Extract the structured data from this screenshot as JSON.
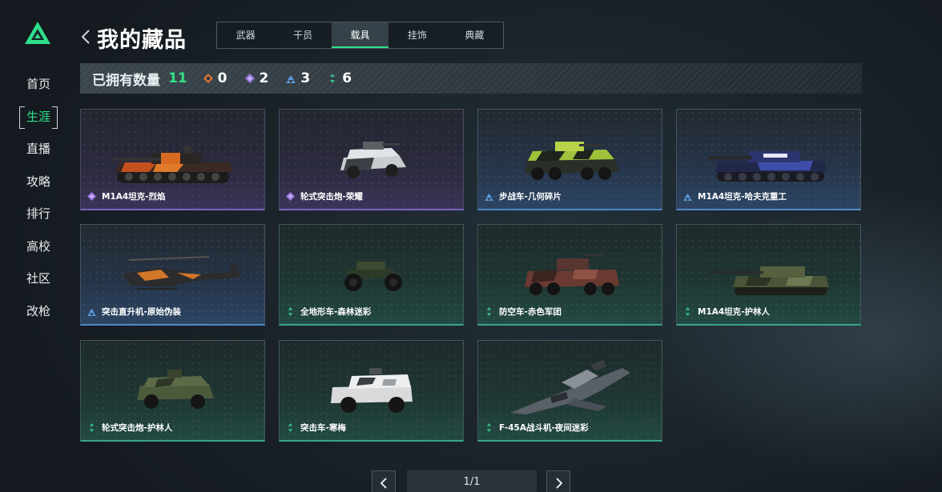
{
  "sidebar": {
    "items": [
      {
        "label": "首页",
        "active": false
      },
      {
        "label": "生涯",
        "active": true
      },
      {
        "label": "直播",
        "active": false
      },
      {
        "label": "攻略",
        "active": false
      },
      {
        "label": "排行",
        "active": false
      },
      {
        "label": "高校",
        "active": false
      },
      {
        "label": "社区",
        "active": false
      },
      {
        "label": "改枪",
        "active": false
      }
    ]
  },
  "header": {
    "title": "我的藏品",
    "tabs": [
      {
        "label": "武器",
        "active": false
      },
      {
        "label": "干员",
        "active": false
      },
      {
        "label": "载具",
        "active": true
      },
      {
        "label": "挂饰",
        "active": false
      },
      {
        "label": "典藏",
        "active": false
      }
    ]
  },
  "summary": {
    "owned_label": "已拥有数量",
    "owned_count": "11",
    "rarities": [
      {
        "icon": "orange-diamond-icon",
        "color": "#e0773a",
        "count": "0"
      },
      {
        "icon": "purple-diamond-icon",
        "color": "#9a78e0",
        "count": "2"
      },
      {
        "icon": "blue-diamond-icon",
        "color": "#5b9ad8",
        "count": "3"
      },
      {
        "icon": "green-diamond-icon",
        "color": "#37c08a",
        "count": "6"
      }
    ]
  },
  "colors": {
    "accent": "#2fe08a",
    "purple": "#9a78e0",
    "blue": "#5b9ad8",
    "green": "#37c08a"
  },
  "items": [
    {
      "name": "M1A4坦克-烈焰",
      "rarity": "purple",
      "art": "tank-icon"
    },
    {
      "name": "轮式突击炮-荣耀",
      "rarity": "purple",
      "art": "armored-car-icon"
    },
    {
      "name": "步战车-几何碎片",
      "rarity": "blue",
      "art": "ifv-icon"
    },
    {
      "name": "M1A4坦克-哈夫克重工",
      "rarity": "blue",
      "art": "tank-icon"
    },
    {
      "name": "突击直升机-原始伪装",
      "rarity": "blue",
      "art": "helicopter-icon"
    },
    {
      "name": "全地形车-森林迷彩",
      "rarity": "green",
      "art": "atv-icon"
    },
    {
      "name": "防空车-赤色军团",
      "rarity": "green",
      "art": "aa-vehicle-icon"
    },
    {
      "name": "M1A4坦克-护林人",
      "rarity": "green",
      "art": "tank-icon"
    },
    {
      "name": "轮式突击炮-护林人",
      "rarity": "green",
      "art": "armored-car-icon"
    },
    {
      "name": "突击车-寒梅",
      "rarity": "green",
      "art": "assault-truck-icon"
    },
    {
      "name": "F-45A战斗机-夜间迷彩",
      "rarity": "green",
      "art": "jet-icon"
    }
  ],
  "pager": {
    "text": "1/1"
  }
}
